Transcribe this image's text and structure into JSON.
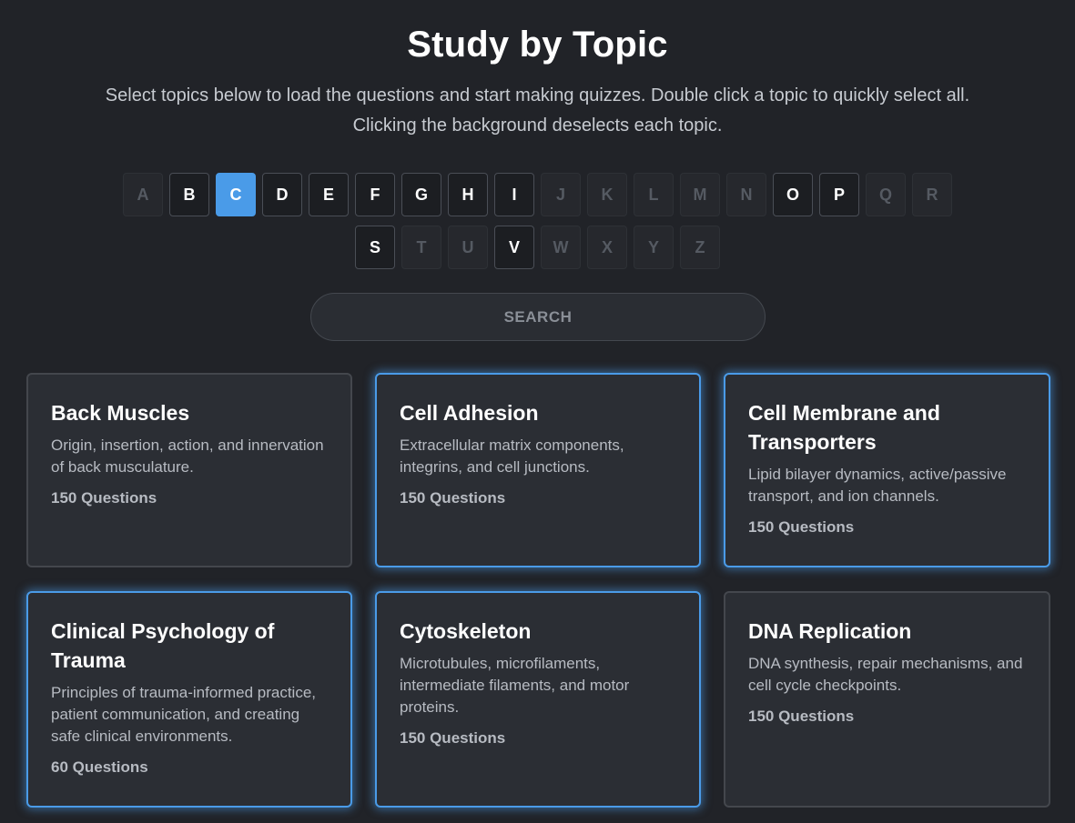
{
  "page": {
    "title": "Study by Topic",
    "subtitle": "Select topics below to load the questions and start making quizzes. Double click a topic to quickly select all. Clicking the background deselects each topic."
  },
  "letters": [
    {
      "label": "A",
      "state": "disabled"
    },
    {
      "label": "B",
      "state": "enabled"
    },
    {
      "label": "C",
      "state": "active"
    },
    {
      "label": "D",
      "state": "enabled"
    },
    {
      "label": "E",
      "state": "enabled"
    },
    {
      "label": "F",
      "state": "enabled"
    },
    {
      "label": "G",
      "state": "enabled"
    },
    {
      "label": "H",
      "state": "enabled"
    },
    {
      "label": "I",
      "state": "enabled"
    },
    {
      "label": "J",
      "state": "disabled"
    },
    {
      "label": "K",
      "state": "disabled"
    },
    {
      "label": "L",
      "state": "disabled"
    },
    {
      "label": "M",
      "state": "disabled"
    },
    {
      "label": "N",
      "state": "disabled"
    },
    {
      "label": "O",
      "state": "enabled"
    },
    {
      "label": "P",
      "state": "enabled"
    },
    {
      "label": "Q",
      "state": "disabled"
    },
    {
      "label": "R",
      "state": "disabled"
    },
    {
      "label": "S",
      "state": "enabled"
    },
    {
      "label": "T",
      "state": "disabled"
    },
    {
      "label": "U",
      "state": "disabled"
    },
    {
      "label": "V",
      "state": "enabled"
    },
    {
      "label": "W",
      "state": "disabled"
    },
    {
      "label": "X",
      "state": "disabled"
    },
    {
      "label": "Y",
      "state": "disabled"
    },
    {
      "label": "Z",
      "state": "disabled"
    }
  ],
  "search": {
    "placeholder": "SEARCH",
    "value": ""
  },
  "topics": [
    {
      "title": "Back Muscles",
      "description": "Origin, insertion, action, and innervation of back musculature.",
      "count": "150 Questions",
      "selected": false
    },
    {
      "title": "Cell Adhesion",
      "description": "Extracellular matrix components, integrins, and cell junctions.",
      "count": "150 Questions",
      "selected": true
    },
    {
      "title": "Cell Membrane and Transporters",
      "description": "Lipid bilayer dynamics, active/passive transport, and ion channels.",
      "count": "150 Questions",
      "selected": true
    },
    {
      "title": "Clinical Psychology of Trauma",
      "description": "Principles of trauma-informed practice, patient communication, and creating safe clinical environments.",
      "count": "60 Questions",
      "selected": true
    },
    {
      "title": "Cytoskeleton",
      "description": "Microtubules, microfilaments, intermediate filaments, and motor proteins.",
      "count": "150 Questions",
      "selected": true
    },
    {
      "title": "DNA Replication",
      "description": "DNA synthesis, repair mechanisms, and cell cycle checkpoints.",
      "count": "150 Questions",
      "selected": false
    }
  ],
  "colors": {
    "background": "#212328",
    "accent": "#4a9be8",
    "card": "#2b2e34"
  }
}
